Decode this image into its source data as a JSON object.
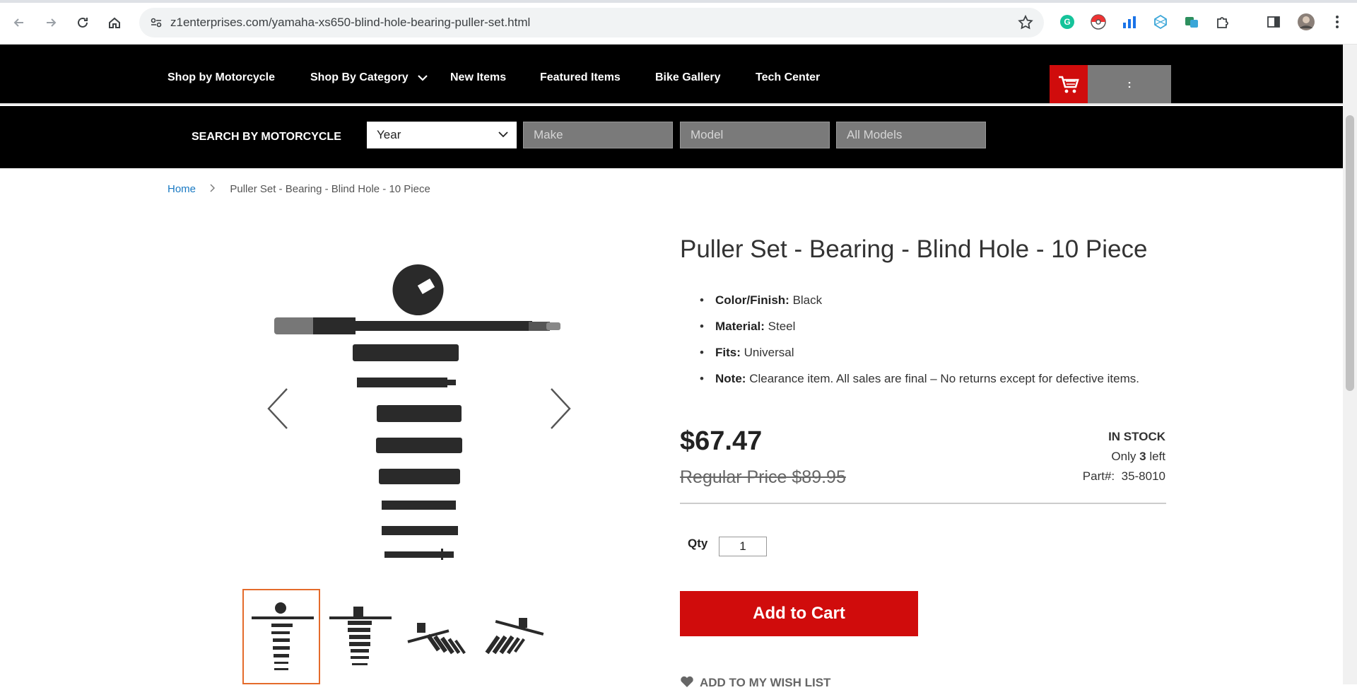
{
  "browser": {
    "url": "z1enterprises.com/yamaha-xs650-blind-hole-bearing-puller-set.html"
  },
  "nav": {
    "items": [
      {
        "label": "Shop by Motorcycle"
      },
      {
        "label": "Shop By Category"
      },
      {
        "label": "New Items"
      },
      {
        "label": "Featured Items"
      },
      {
        "label": "Bike Gallery"
      },
      {
        "label": "Tech Center"
      }
    ],
    "cart_count": ":"
  },
  "search": {
    "label": "SEARCH BY MOTORCYCLE",
    "year": "Year",
    "make": "Make",
    "model": "Model",
    "all_models": "All Models"
  },
  "breadcrumb": {
    "home": "Home",
    "current": "Puller Set - Bearing - Blind Hole - 10 Piece"
  },
  "product": {
    "title": "Puller Set - Bearing - Blind Hole - 10 Piece",
    "specs": [
      {
        "label": "Color/Finish:",
        "value": "Black"
      },
      {
        "label": "Material:",
        "value": "Steel"
      },
      {
        "label": "Fits:",
        "value": "Universal"
      },
      {
        "label": "Note:",
        "value": "Clearance item. All sales are final – No returns except for defective items."
      }
    ],
    "price": "$67.47",
    "regular_price": "Regular Price $89.95",
    "stock_status": "IN STOCK",
    "only_prefix": "Only",
    "only_count": "3",
    "only_suffix": "left",
    "part_label": "Part#:",
    "part_number": "35-8010",
    "qty_label": "Qty",
    "qty_value": "1",
    "add_to_cart": "Add to Cart",
    "wishlist": "ADD TO MY WISH LIST"
  },
  "colors": {
    "accent_red": "#d00c0c",
    "link_blue": "#1979c3",
    "thumb_active": "#e46b2b"
  }
}
